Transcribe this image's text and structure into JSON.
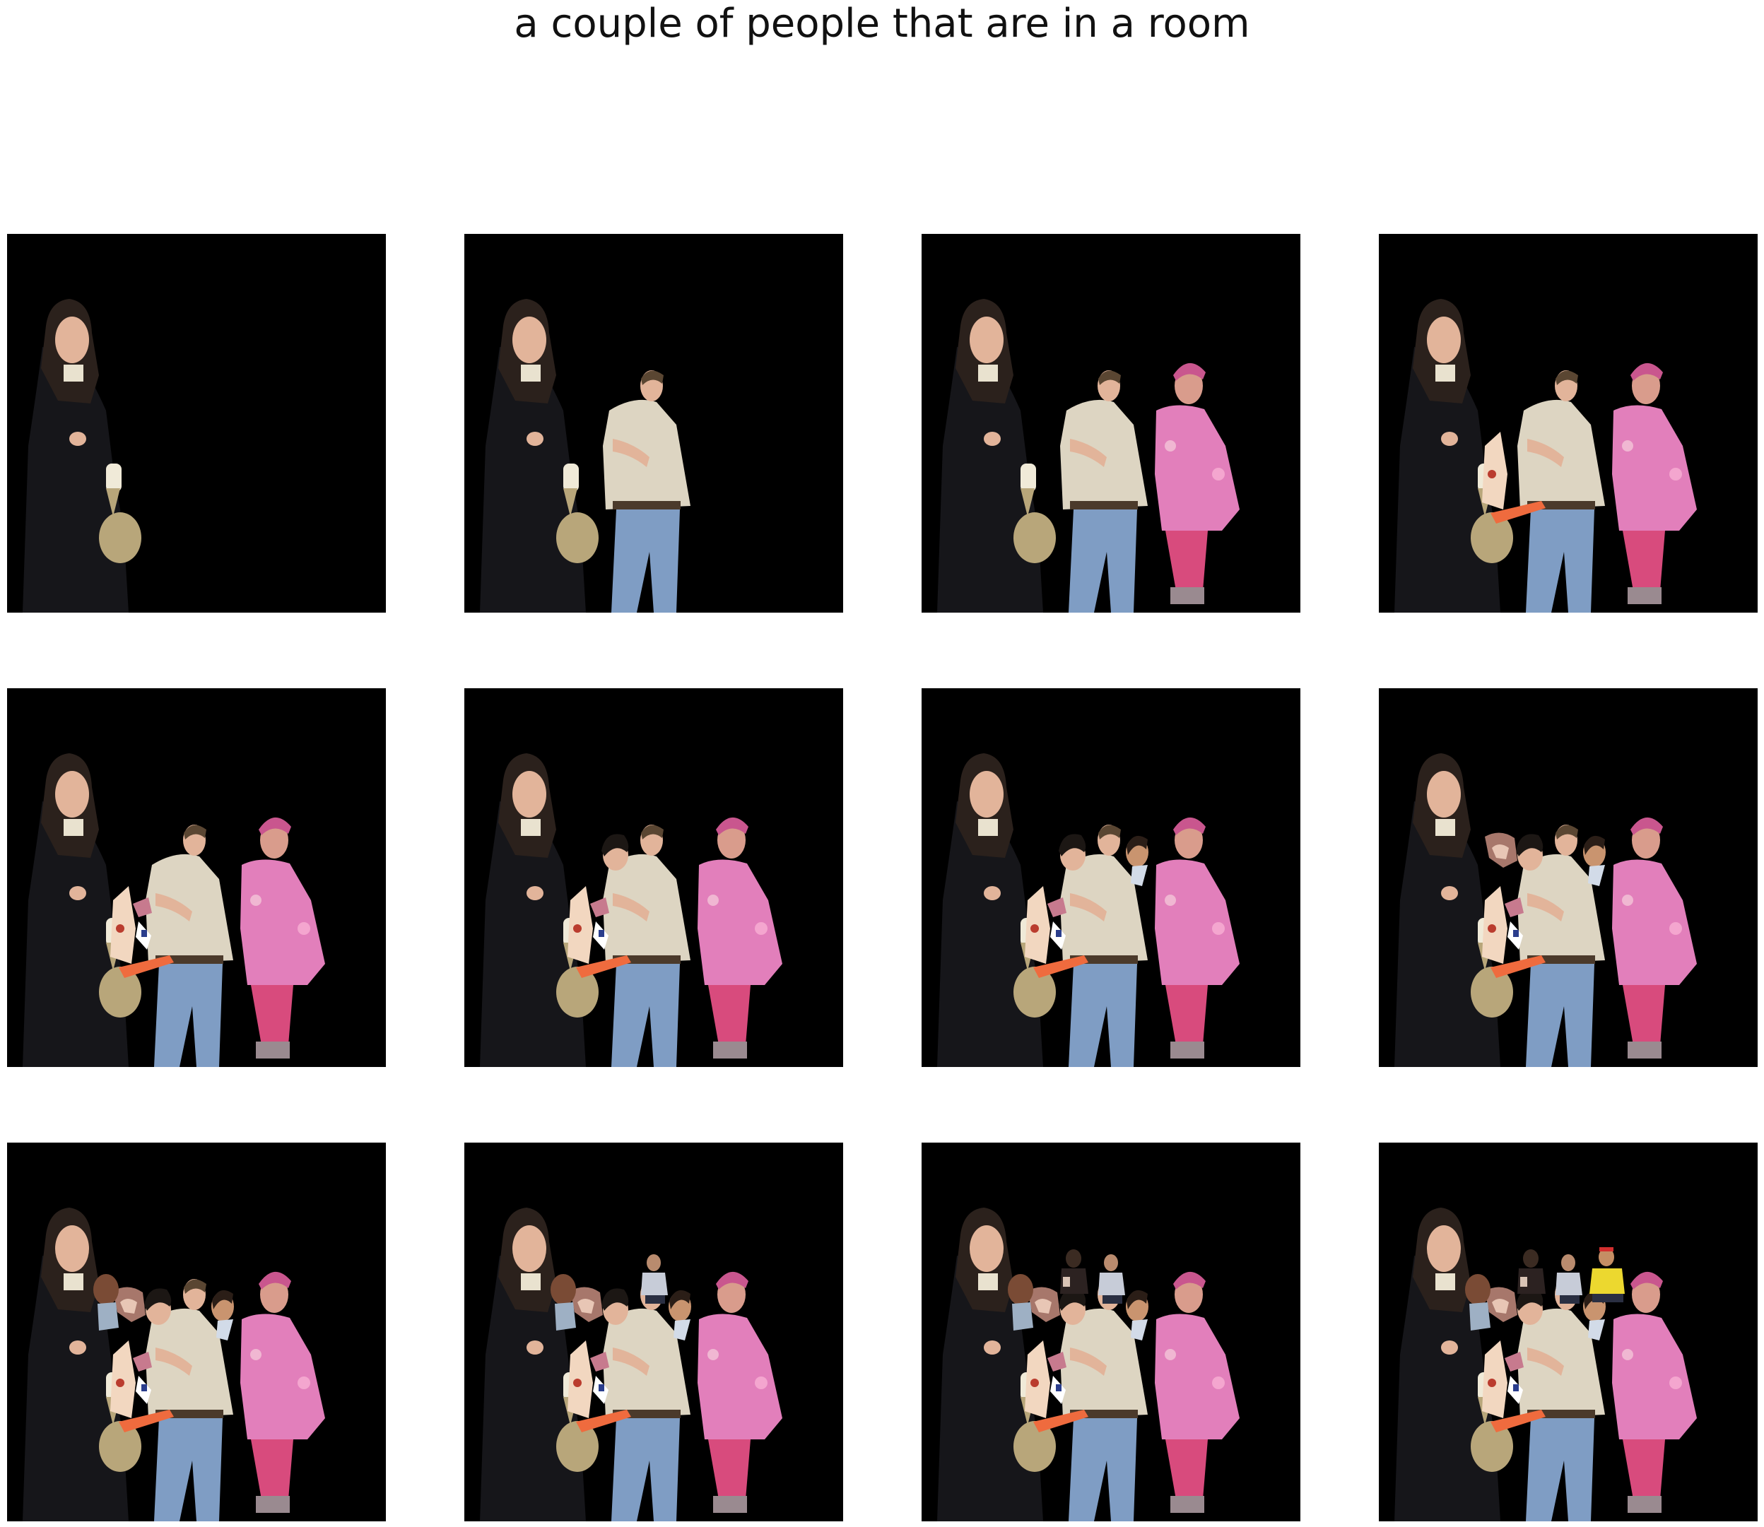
{
  "title": "a couple of people that are in a room",
  "panels": [
    {
      "step": 1,
      "layers": [
        "woman-left"
      ]
    },
    {
      "step": 2,
      "layers": [
        "woman-left",
        "man-center"
      ]
    },
    {
      "step": 3,
      "layers": [
        "woman-left",
        "man-center",
        "person-pink-jacket"
      ]
    },
    {
      "step": 4,
      "layers": [
        "woman-left",
        "man-center",
        "person-pink-jacket",
        "fragment-arm"
      ]
    },
    {
      "step": 5,
      "layers": [
        "woman-left",
        "man-center",
        "person-pink-jacket",
        "fragment-arm",
        "fragment-small"
      ]
    },
    {
      "step": 6,
      "layers": [
        "woman-left",
        "man-center",
        "person-pink-jacket",
        "fragment-arm",
        "fragment-small",
        "head-dark-hair"
      ]
    },
    {
      "step": 7,
      "layers": [
        "woman-left",
        "man-center",
        "person-pink-jacket",
        "fragment-arm",
        "fragment-small",
        "head-dark-hair",
        "head-right"
      ]
    },
    {
      "step": 8,
      "layers": [
        "woman-left",
        "man-center",
        "person-pink-jacket",
        "fragment-arm",
        "fragment-small",
        "head-dark-hair",
        "head-right",
        "fragment-hair"
      ]
    },
    {
      "step": 9,
      "layers": [
        "woman-left",
        "man-center",
        "person-pink-jacket",
        "fragment-arm",
        "fragment-small",
        "head-dark-hair",
        "head-right",
        "fragment-hair",
        "head-back"
      ]
    },
    {
      "step": 10,
      "layers": [
        "woman-left",
        "man-center",
        "person-pink-jacket",
        "fragment-arm",
        "fragment-small",
        "head-dark-hair",
        "head-right",
        "fragment-hair",
        "head-back",
        "small-figure"
      ]
    },
    {
      "step": 11,
      "layers": [
        "woman-left",
        "man-center",
        "person-pink-jacket",
        "fragment-arm",
        "fragment-small",
        "head-dark-hair",
        "head-right",
        "fragment-hair",
        "head-back",
        "small-figure",
        "small-figure-dark"
      ]
    },
    {
      "step": 12,
      "layers": [
        "woman-left",
        "man-center",
        "person-pink-jacket",
        "fragment-arm",
        "fragment-small",
        "head-dark-hair",
        "head-right",
        "fragment-hair",
        "head-back",
        "small-figure",
        "small-figure-dark",
        "figure-yellow-shirt"
      ]
    }
  ],
  "colors": {
    "background": "#000000",
    "coat": "#16161a",
    "hair": "#2b211c",
    "skin": "#e2b49a",
    "shirt": "#ddd5c2",
    "jeans": "#7f9dc4",
    "pink": "#e27fbb",
    "bag": "#b8a67a",
    "yellow": "#ecd82f"
  }
}
